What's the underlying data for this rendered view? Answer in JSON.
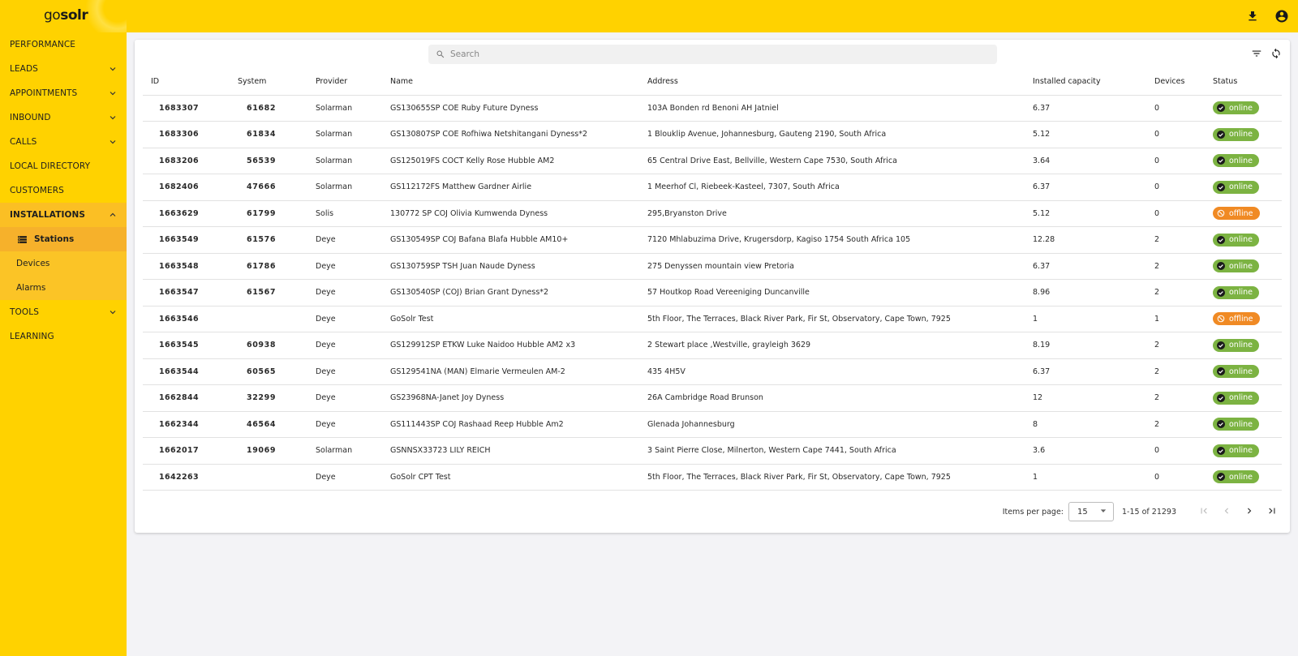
{
  "brand": {
    "prefix": "go",
    "suffix": "solr"
  },
  "topbar": {
    "icons": [
      "download-icon",
      "account-circle-icon"
    ]
  },
  "sidebar": {
    "items": [
      {
        "label": "PERFORMANCE",
        "expandable": false
      },
      {
        "label": "LEADS",
        "expandable": true
      },
      {
        "label": "APPOINTMENTS",
        "expandable": true
      },
      {
        "label": "INBOUND",
        "expandable": true
      },
      {
        "label": "CALLS",
        "expandable": true
      },
      {
        "label": "LOCAL DIRECTORY",
        "expandable": false
      },
      {
        "label": "CUSTOMERS",
        "expandable": false
      },
      {
        "label": "INSTALLATIONS",
        "expandable": true,
        "expanded": true
      },
      {
        "label": "TOOLS",
        "expandable": true
      },
      {
        "label": "LEARNING",
        "expandable": false
      }
    ],
    "installations_sub": [
      {
        "label": "Stations",
        "selected": true
      },
      {
        "label": "Devices"
      },
      {
        "label": "Alarms"
      }
    ]
  },
  "search": {
    "placeholder": "Search",
    "value": ""
  },
  "table": {
    "headers": {
      "id": "ID",
      "system": "System",
      "provider": "Provider",
      "name": "Name",
      "address": "Address",
      "capacity": "Installed capacity",
      "devices": "Devices",
      "status": "Status"
    },
    "rows": [
      {
        "id": "1683307",
        "system": "61682",
        "provider": "Solarman",
        "name": "GS130655SP COE Ruby Future Dyness",
        "address": "103A Bonden rd Benoni AH Jatniel",
        "capacity": "6.37",
        "devices": "0",
        "status": "online"
      },
      {
        "id": "1683306",
        "system": "61834",
        "provider": "Solarman",
        "name": "GS130807SP COE Rofhiwa Netshitangani Dyness*2",
        "address": "1 Blouklip Avenue, Johannesburg, Gauteng 2190, South Africa",
        "capacity": "5.12",
        "devices": "0",
        "status": "online"
      },
      {
        "id": "1683206",
        "system": "56539",
        "provider": "Solarman",
        "name": "GS125019FS COCT Kelly Rose Hubble AM2",
        "address": "65 Central Drive East, Bellville, Western Cape 7530, South Africa",
        "capacity": "3.64",
        "devices": "0",
        "status": "online"
      },
      {
        "id": "1682406",
        "system": "47666",
        "provider": "Solarman",
        "name": "GS112172FS Matthew Gardner Airlie",
        "address": "1 Meerhof Cl, Riebeek-Kasteel, 7307, South Africa",
        "capacity": "6.37",
        "devices": "0",
        "status": "online"
      },
      {
        "id": "1663629",
        "system": "61799",
        "provider": "Solis",
        "name": "130772 SP COJ Olivia Kumwenda Dyness",
        "address": "295,Bryanston Drive",
        "capacity": "5.12",
        "devices": "0",
        "status": "offline"
      },
      {
        "id": "1663549",
        "system": "61576",
        "provider": "Deye",
        "name": "GS130549SP COJ Bafana Blafa Hubble AM10+",
        "address": "7120 Mhlabuzima Drive, Krugersdorp, Kagiso 1754 South Africa 105",
        "capacity": "12.28",
        "devices": "2",
        "status": "online"
      },
      {
        "id": "1663548",
        "system": "61786",
        "provider": "Deye",
        "name": "GS130759SP TSH Juan Naude Dyness",
        "address": "275 Denyssen mountain view Pretoria",
        "capacity": "6.37",
        "devices": "2",
        "status": "online"
      },
      {
        "id": "1663547",
        "system": "61567",
        "provider": "Deye",
        "name": "GS130540SP (COJ) Brian Grant Dyness*2",
        "address": "57 Houtkop Road Vereeniging Duncanville",
        "capacity": "8.96",
        "devices": "2",
        "status": "online"
      },
      {
        "id": "1663546",
        "system": "",
        "provider": "Deye",
        "name": "GoSolr Test",
        "address": "5th Floor, The Terraces, Black River Park, Fir St, Observatory, Cape Town, 7925",
        "capacity": "1",
        "devices": "1",
        "status": "offline"
      },
      {
        "id": "1663545",
        "system": "60938",
        "provider": "Deye",
        "name": "GS129912SP ETKW Luke Naidoo Hubble AM2 x3",
        "address": "2 Stewart place ,Westville, grayleigh 3629",
        "capacity": "8.19",
        "devices": "2",
        "status": "online"
      },
      {
        "id": "1663544",
        "system": "60565",
        "provider": "Deye",
        "name": "GS129541NA (MAN) Elmarie Vermeulen AM-2",
        "address": "435 4H5V",
        "capacity": "6.37",
        "devices": "2",
        "status": "online"
      },
      {
        "id": "1662844",
        "system": "32299",
        "provider": "Deye",
        "name": "GS23968NA-Janet Joy Dyness",
        "address": "26A Cambridge Road Brunson",
        "capacity": "12",
        "devices": "2",
        "status": "online"
      },
      {
        "id": "1662344",
        "system": "46564",
        "provider": "Deye",
        "name": "GS111443SP COJ Rashaad Reep Hubble Am2",
        "address": "Glenada Johannesburg",
        "capacity": "8",
        "devices": "2",
        "status": "online"
      },
      {
        "id": "1662017",
        "system": "19069",
        "provider": "Solarman",
        "name": "GSNNSX33723 LILY REICH",
        "address": "3 Saint Pierre Close, Milnerton, Western Cape 7441, South Africa",
        "capacity": "3.6",
        "devices": "0",
        "status": "online"
      },
      {
        "id": "1642263",
        "system": "",
        "provider": "Deye",
        "name": "GoSolr CPT Test",
        "address": "5th Floor, The Terraces, Black River Park, Fir St, Observatory, Cape Town, 7925",
        "capacity": "1",
        "devices": "0",
        "status": "online"
      }
    ]
  },
  "paginator": {
    "items_per_page_label": "Items per page:",
    "items_per_page": "15",
    "range": "1-15 of 21293"
  },
  "colors": {
    "brand_yellow": "#ffd200",
    "online": "#7cb342",
    "offline": "#f08a24"
  }
}
